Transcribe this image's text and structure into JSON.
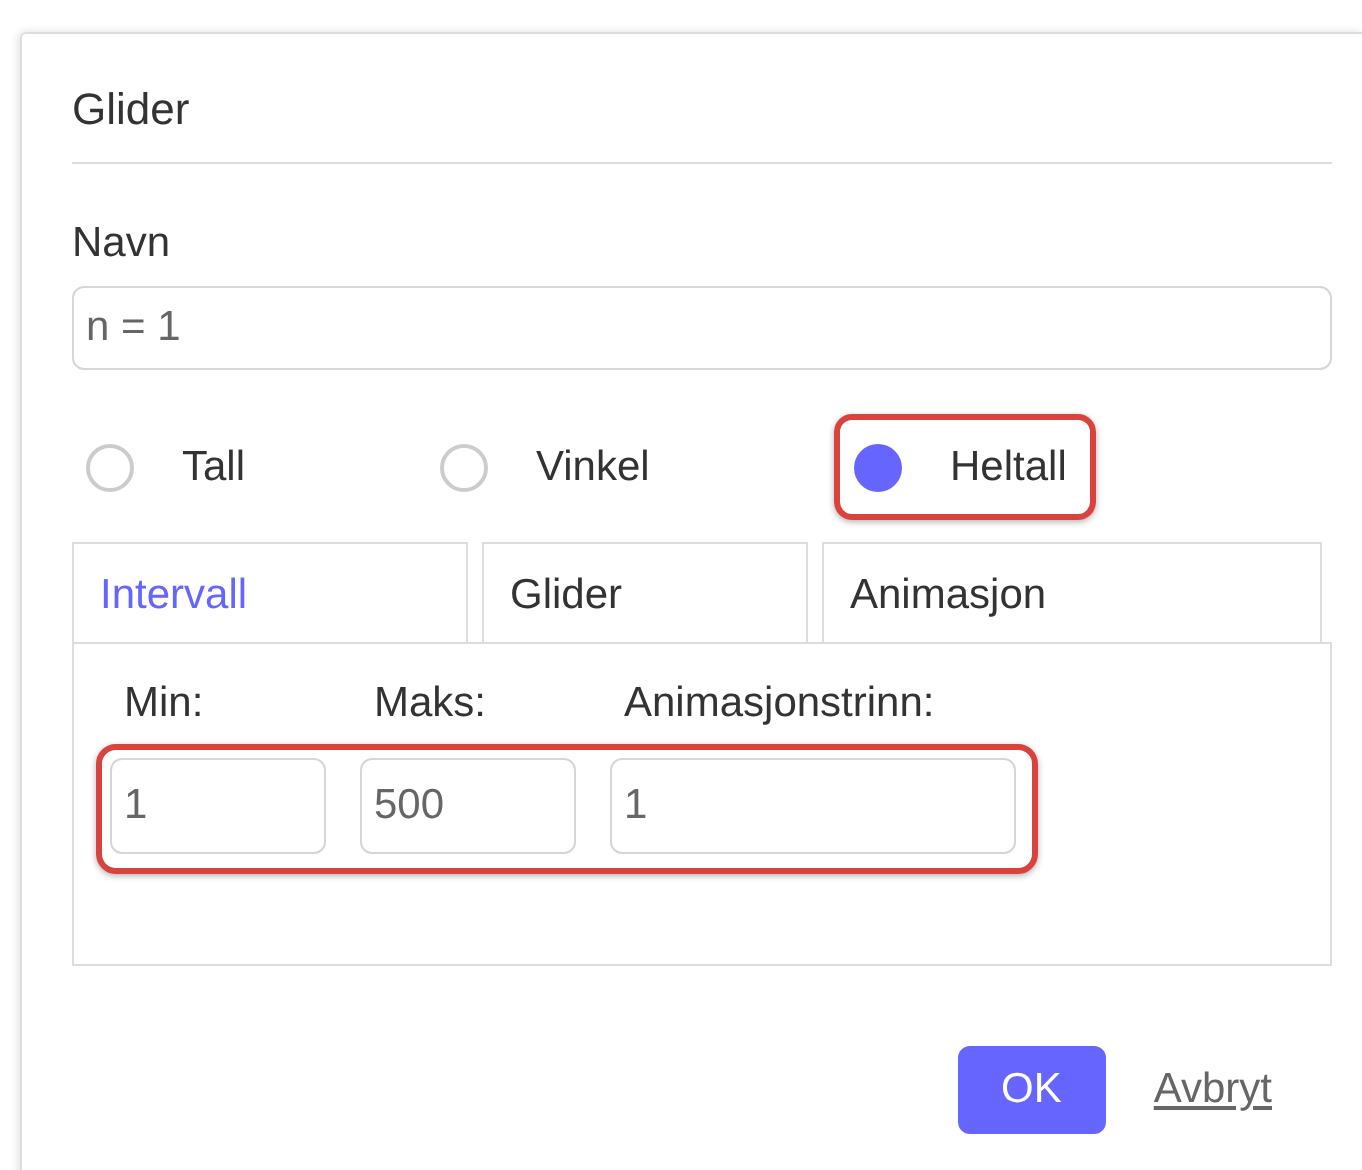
{
  "dialog": {
    "title": "Glider"
  },
  "name_field": {
    "label": "Navn",
    "value": "n = 1"
  },
  "radios": [
    {
      "label": "Tall",
      "selected": false,
      "highlighted": false
    },
    {
      "label": "Vinkel",
      "selected": false,
      "highlighted": false
    },
    {
      "label": "Heltall",
      "selected": true,
      "highlighted": true
    }
  ],
  "tabs": [
    {
      "label": "Intervall",
      "selected": true
    },
    {
      "label": "Glider",
      "selected": false
    },
    {
      "label": "Animasjon",
      "selected": false
    }
  ],
  "interval_fields_highlighted": true,
  "interval_fields": [
    {
      "label": "Min:",
      "value": "1"
    },
    {
      "label": "Maks:",
      "value": "500"
    },
    {
      "label": "Animasjonstrinn:",
      "value": "1"
    }
  ],
  "buttons": [
    {
      "kind": "primary",
      "label": "OK"
    },
    {
      "kind": "link",
      "label": "Avbryt"
    }
  ]
}
